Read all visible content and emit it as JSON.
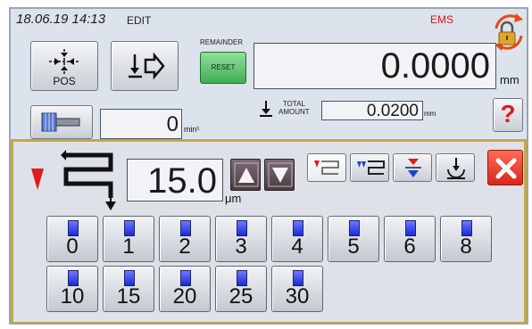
{
  "header": {
    "datetime": "18.06.19 14:13",
    "mode": "EDIT",
    "ems": "EMS"
  },
  "toolbar": {
    "pos_label": "POS",
    "remainder_label": "REMAINDER",
    "reset_label": "RESET",
    "remainder_value": "0.0000",
    "remainder_unit": "mm"
  },
  "spindle": {
    "rpm_value": "0",
    "rpm_unit": "min¹"
  },
  "total": {
    "label_line1": "TOTAL",
    "label_line2": "AMOUNT",
    "value": "0.0200",
    "unit": "mm"
  },
  "help": {
    "label": "?"
  },
  "popup": {
    "value": "15.0",
    "unit": "μm",
    "keys": [
      "0",
      "1",
      "2",
      "3",
      "4",
      "5",
      "6",
      "8",
      "10",
      "15",
      "20",
      "25",
      "30"
    ]
  },
  "colors": {
    "popup_border": "#c8a640",
    "close_red": "#d8281c",
    "indicator_red": "#e01b1b",
    "key_led_blue": "#1c2ad6",
    "reset_green": "#3fae52"
  }
}
